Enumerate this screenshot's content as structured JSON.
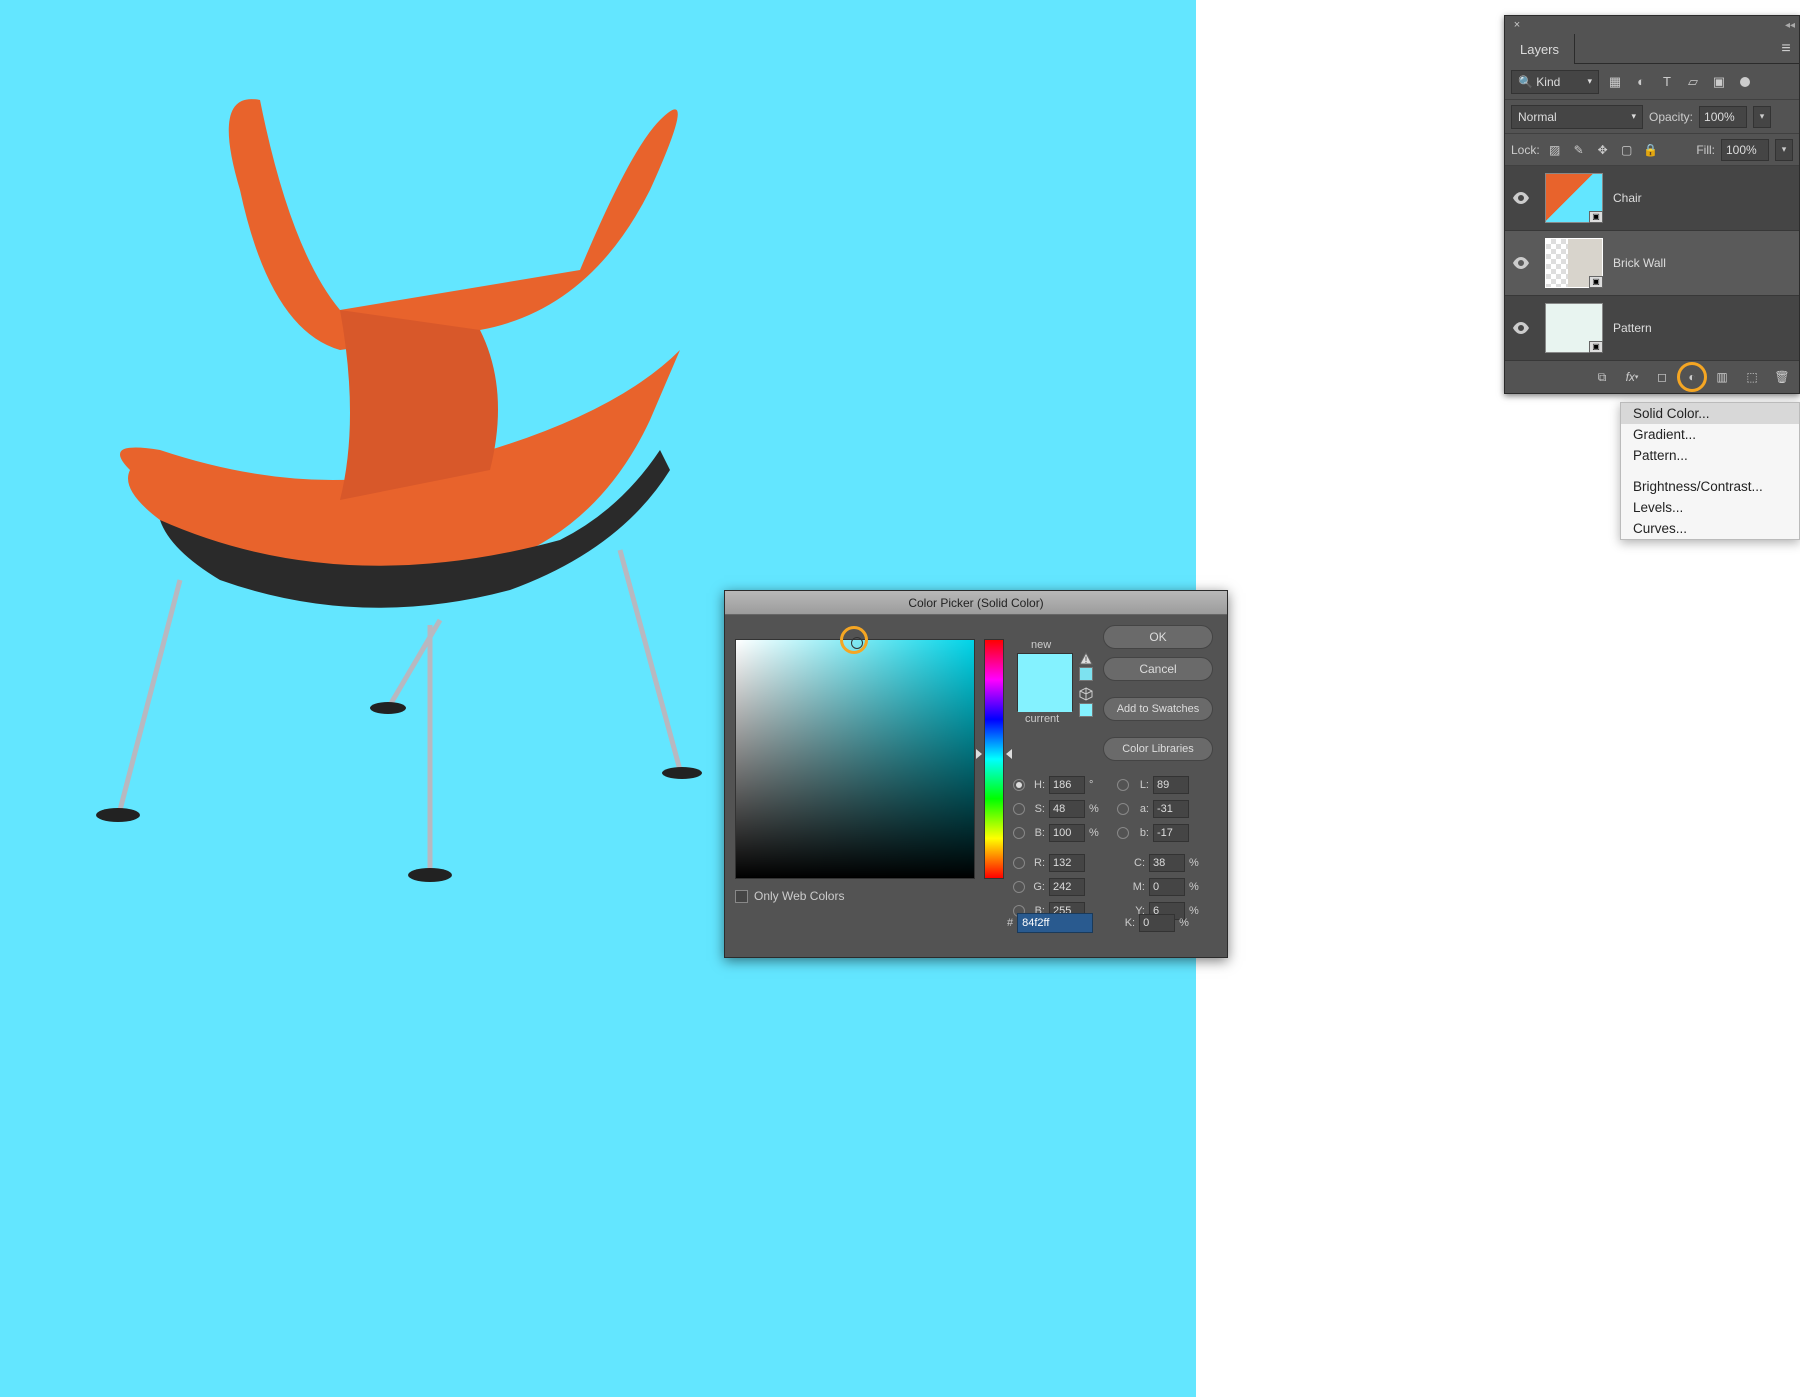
{
  "canvas": {
    "bg_color": "#63e6ff"
  },
  "layers_panel": {
    "title": "Layers",
    "filter_kind": "Kind",
    "blend_mode": "Normal",
    "opacity_label": "Opacity:",
    "opacity_value": "100%",
    "lock_label": "Lock:",
    "fill_label": "Fill:",
    "fill_value": "100%",
    "layers": [
      {
        "name": "Chair",
        "selected": false
      },
      {
        "name": "Brick Wall",
        "selected": true
      },
      {
        "name": "Pattern",
        "selected": false
      }
    ]
  },
  "adjustment_menu": {
    "items_group1": [
      "Solid Color...",
      "Gradient...",
      "Pattern..."
    ],
    "items_group2": [
      "Brightness/Contrast...",
      "Levels...",
      "Curves..."
    ]
  },
  "color_picker": {
    "title": "Color Picker (Solid Color)",
    "new_label": "new",
    "current_label": "current",
    "buttons": {
      "ok": "OK",
      "cancel": "Cancel",
      "add": "Add to Swatches",
      "lib": "Color Libraries"
    },
    "hsb": {
      "H": "186",
      "H_unit": "°",
      "S": "48",
      "S_unit": "%",
      "B": "100",
      "B_unit": "%"
    },
    "lab": {
      "L": "89",
      "a": "-31",
      "b": "-17"
    },
    "rgb": {
      "R": "132",
      "G": "242",
      "B": "255"
    },
    "cmyk": {
      "C": "38",
      "M": "0",
      "Y": "6",
      "K": "0"
    },
    "hex_prefix": "#",
    "hex": "84f2ff",
    "web_only": "Only Web Colors",
    "swatch_new": "#84f2ff",
    "swatch_current": "#84f2ff"
  }
}
